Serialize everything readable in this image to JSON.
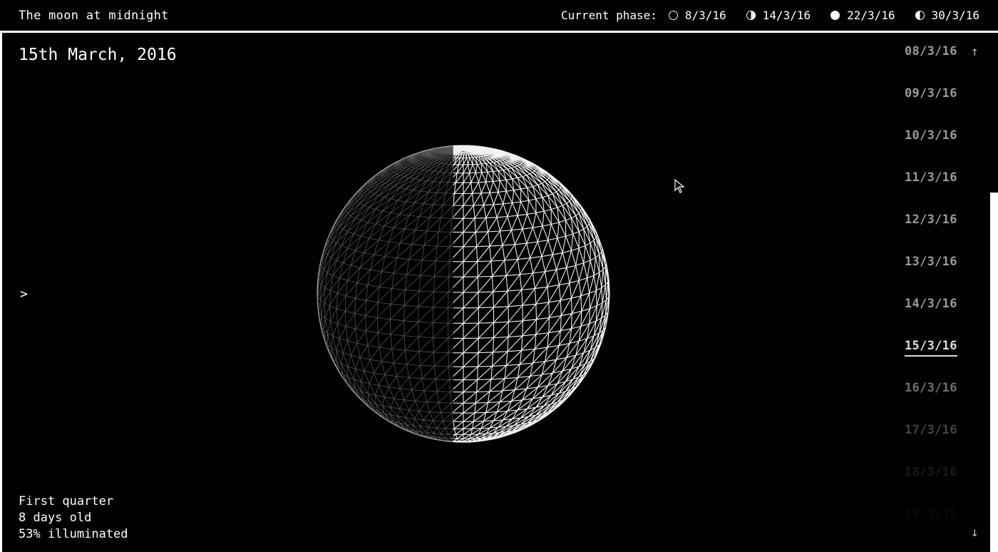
{
  "header": {
    "title": "The moon at midnight",
    "phase_label": "Current phase:",
    "phases": [
      {
        "icon": "new-moon-icon",
        "date": "8/3/16"
      },
      {
        "icon": "first-quarter-icon",
        "date": "14/3/16"
      },
      {
        "icon": "full-moon-icon",
        "date": "22/3/16"
      },
      {
        "icon": "last-quarter-icon",
        "date": "30/3/16"
      }
    ]
  },
  "main": {
    "date_title": "15th March, 2016",
    "toggle": ">",
    "info": {
      "phase_name": "First quarter",
      "age": "8 days old",
      "illumination": "53% illuminated"
    }
  },
  "date_list": {
    "up_arrow": "↑",
    "down_arrow": "↓",
    "active_index": 7,
    "items": [
      "08/3/16",
      "09/3/16",
      "10/3/16",
      "11/3/16",
      "12/3/16",
      "13/3/16",
      "14/3/16",
      "15/3/16",
      "16/3/16",
      "17/3/16",
      "18/3/16",
      "19/3/16"
    ]
  },
  "moon": {
    "illuminated_fraction": 0.53,
    "lit_side": "right",
    "color": "#ffffff",
    "background": "#000000"
  }
}
